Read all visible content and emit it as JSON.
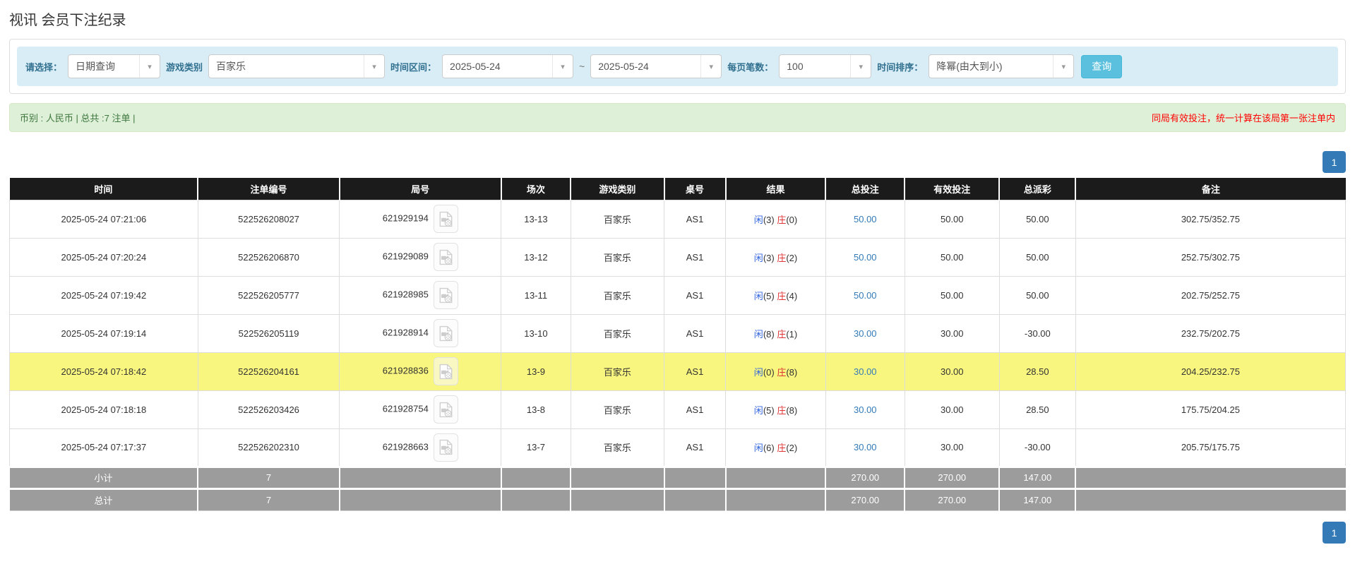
{
  "colors": {
    "accent_blue": "#337ab7",
    "search_button_blue": "#5bc0de",
    "player_blue": "#3366dd",
    "banker_red": "#e03333",
    "negative_red": "#ff0000",
    "highlight_yellow": "#f8f67e"
  },
  "icons": {
    "chevron_down": "▾"
  },
  "page": {
    "title": "视讯 会员下注纪录"
  },
  "filters": {
    "select_label": "请选择：",
    "select_value": "日期查询",
    "game_type_label": "游戏类别",
    "game_type_value": "百家乐",
    "time_range_label": "时间区间：",
    "date_from": "2025-05-24",
    "tilde": "~",
    "date_to": "2025-05-24",
    "page_size_label": "每页笔数：",
    "page_size_value": "100",
    "sort_label": "时间排序：",
    "sort_value": "降幂(由大到小)",
    "search_button_label": "查询"
  },
  "summary": {
    "currency_info": "币别 : 人民币 | 总共 :7 注单 |",
    "notice": "同局有效投注，统一计算在该局第一张注单内"
  },
  "pagination": {
    "current_page": "1"
  },
  "table": {
    "headers": [
      "时间",
      "注单编号",
      "局号",
      "场次",
      "游戏类别",
      "桌号",
      "结果",
      "总投注",
      "有效投注",
      "总派彩",
      "备注"
    ],
    "rows": [
      {
        "time": "2025-05-24 07:21:06",
        "bet_id": "522526208027",
        "round_id": "621929194",
        "session": "13-13",
        "game_type": "百家乐",
        "table_no": "AS1",
        "result": {
          "player": "闲",
          "player_count": "(3)",
          "banker": "庄",
          "banker_count": "(0)"
        },
        "total_bet": "50.00",
        "valid_bet": "50.00",
        "payout": "50.00",
        "payout_negative": false,
        "remark": "302.75/352.75",
        "highlight": false
      },
      {
        "time": "2025-05-24 07:20:24",
        "bet_id": "522526206870",
        "round_id": "621929089",
        "session": "13-12",
        "game_type": "百家乐",
        "table_no": "AS1",
        "result": {
          "player": "闲",
          "player_count": "(3)",
          "banker": "庄",
          "banker_count": "(2)"
        },
        "total_bet": "50.00",
        "valid_bet": "50.00",
        "payout": "50.00",
        "payout_negative": false,
        "remark": "252.75/302.75",
        "highlight": false
      },
      {
        "time": "2025-05-24 07:19:42",
        "bet_id": "522526205777",
        "round_id": "621928985",
        "session": "13-11",
        "game_type": "百家乐",
        "table_no": "AS1",
        "result": {
          "player": "闲",
          "player_count": "(5)",
          "banker": "庄",
          "banker_count": "(4)"
        },
        "total_bet": "50.00",
        "valid_bet": "50.00",
        "payout": "50.00",
        "payout_negative": false,
        "remark": "202.75/252.75",
        "highlight": false
      },
      {
        "time": "2025-05-24 07:19:14",
        "bet_id": "522526205119",
        "round_id": "621928914",
        "session": "13-10",
        "game_type": "百家乐",
        "table_no": "AS1",
        "result": {
          "player": "闲",
          "player_count": "(8)",
          "banker": "庄",
          "banker_count": "(1)"
        },
        "total_bet": "30.00",
        "valid_bet": "30.00",
        "payout": "-30.00",
        "payout_negative": true,
        "remark": "232.75/202.75",
        "highlight": false
      },
      {
        "time": "2025-05-24 07:18:42",
        "bet_id": "522526204161",
        "round_id": "621928836",
        "session": "13-9",
        "game_type": "百家乐",
        "table_no": "AS1",
        "result": {
          "player": "闲",
          "player_count": "(0)",
          "banker": "庄",
          "banker_count": "(8)"
        },
        "total_bet": "30.00",
        "valid_bet": "30.00",
        "payout": "28.50",
        "payout_negative": false,
        "remark": "204.25/232.75",
        "highlight": true
      },
      {
        "time": "2025-05-24 07:18:18",
        "bet_id": "522526203426",
        "round_id": "621928754",
        "session": "13-8",
        "game_type": "百家乐",
        "table_no": "AS1",
        "result": {
          "player": "闲",
          "player_count": "(5)",
          "banker": "庄",
          "banker_count": "(8)"
        },
        "total_bet": "30.00",
        "valid_bet": "30.00",
        "payout": "28.50",
        "payout_negative": false,
        "remark": "175.75/204.25",
        "highlight": false
      },
      {
        "time": "2025-05-24 07:17:37",
        "bet_id": "522526202310",
        "round_id": "621928663",
        "session": "13-7",
        "game_type": "百家乐",
        "table_no": "AS1",
        "result": {
          "player": "闲",
          "player_count": "(6)",
          "banker": "庄",
          "banker_count": "(2)"
        },
        "total_bet": "30.00",
        "valid_bet": "30.00",
        "payout": "-30.00",
        "payout_negative": true,
        "remark": "205.75/175.75",
        "highlight": false
      }
    ],
    "subtotal": {
      "label": "小计",
      "count": "7",
      "total_bet": "270.00",
      "valid_bet": "270.00",
      "payout": "147.00"
    },
    "grand_total": {
      "label": "总计",
      "count": "7",
      "total_bet": "270.00",
      "valid_bet": "270.00",
      "payout": "147.00"
    }
  }
}
